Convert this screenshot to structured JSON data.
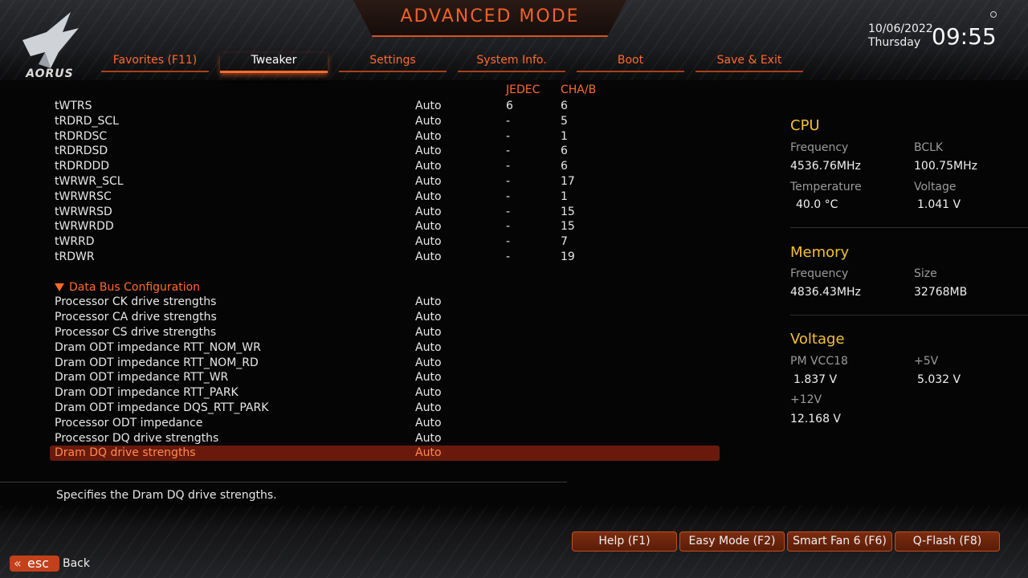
{
  "header": {
    "title": "ADVANCED MODE",
    "brand": "AORUS",
    "date": "10/06/2022",
    "day": "Thursday",
    "time": "09:55"
  },
  "tabs": [
    {
      "label": "Favorites (F11)",
      "active": false
    },
    {
      "label": "Tweaker",
      "active": true
    },
    {
      "label": "Settings",
      "active": false
    },
    {
      "label": "System Info.",
      "active": false
    },
    {
      "label": "Boot",
      "active": false
    },
    {
      "label": "Save & Exit",
      "active": false
    }
  ],
  "columns": {
    "jedec": "JEDEC",
    "chab": "CHA/B"
  },
  "rows": [
    {
      "label": "tWTRS",
      "value": "Auto",
      "jedec": "6",
      "chab": "6"
    },
    {
      "label": "tRDRD_SCL",
      "value": "Auto",
      "jedec": "-",
      "chab": "5"
    },
    {
      "label": "tRDRDSC",
      "value": "Auto",
      "jedec": "-",
      "chab": "1"
    },
    {
      "label": "tRDRDSD",
      "value": "Auto",
      "jedec": "-",
      "chab": "6"
    },
    {
      "label": "tRDRDDD",
      "value": "Auto",
      "jedec": "-",
      "chab": "6"
    },
    {
      "label": "tWRWR_SCL",
      "value": "Auto",
      "jedec": "-",
      "chab": "17"
    },
    {
      "label": "tWRWRSC",
      "value": "Auto",
      "jedec": "-",
      "chab": "1"
    },
    {
      "label": "tWRWRSD",
      "value": "Auto",
      "jedec": "-",
      "chab": "15"
    },
    {
      "label": "tWRWRDD",
      "value": "Auto",
      "jedec": "-",
      "chab": "15"
    },
    {
      "label": "tWRRD",
      "value": "Auto",
      "jedec": "-",
      "chab": "7"
    },
    {
      "label": "tRDWR",
      "value": "Auto",
      "jedec": "-",
      "chab": "19"
    },
    {
      "label": "",
      "value": "",
      "jedec": "",
      "chab": ""
    },
    {
      "label": "Data Bus Configuration",
      "value": "",
      "jedec": "",
      "chab": "",
      "section": true
    },
    {
      "label": "Processor CK drive strengths",
      "value": "Auto",
      "jedec": "",
      "chab": ""
    },
    {
      "label": "Processor CA drive strengths",
      "value": "Auto",
      "jedec": "",
      "chab": ""
    },
    {
      "label": "Processor CS drive strengths",
      "value": "Auto",
      "jedec": "",
      "chab": ""
    },
    {
      "label": "Dram ODT impedance RTT_NOM_WR",
      "value": "Auto",
      "jedec": "",
      "chab": ""
    },
    {
      "label": "Dram ODT impedance RTT_NOM_RD",
      "value": "Auto",
      "jedec": "",
      "chab": ""
    },
    {
      "label": "Dram ODT impedance RTT_WR",
      "value": "Auto",
      "jedec": "",
      "chab": ""
    },
    {
      "label": "Dram ODT impedance RTT_PARK",
      "value": "Auto",
      "jedec": "",
      "chab": ""
    },
    {
      "label": "Dram ODT impedance DQS_RTT_PARK",
      "value": "Auto",
      "jedec": "",
      "chab": ""
    },
    {
      "label": "Processor ODT impedance",
      "value": "Auto",
      "jedec": "",
      "chab": ""
    },
    {
      "label": "Processor DQ drive strengths",
      "value": "Auto",
      "jedec": "",
      "chab": ""
    },
    {
      "label": "Dram DQ drive strengths",
      "value": "Auto",
      "jedec": "",
      "chab": "",
      "selected": true
    }
  ],
  "description": "Specifies the Dram DQ drive strengths.",
  "side": {
    "cpu": {
      "title": "CPU",
      "frequency_label": "Frequency",
      "frequency": "4536.76MHz",
      "bclk_label": "BCLK",
      "bclk": "100.75MHz",
      "temperature_label": "Temperature",
      "temperature": "40.0 °C",
      "voltage_label": "Voltage",
      "voltage": "1.041 V"
    },
    "memory": {
      "title": "Memory",
      "frequency_label": "Frequency",
      "frequency": "4836.43MHz",
      "size_label": "Size",
      "size": "32768MB"
    },
    "voltage": {
      "title": "Voltage",
      "pmvcc18_label": "PM VCC18",
      "pmvcc18": "1.837 V",
      "p5v_label": "+5V",
      "p5v": "5.032 V",
      "p12v_label": "+12V",
      "p12v": "12.168 V"
    }
  },
  "footer": {
    "help": "Help (F1)",
    "easy": "Easy Mode (F2)",
    "smartfan": "Smart Fan 6 (F6)",
    "qflash": "Q-Flash (F8)",
    "esc": "esc",
    "back": "Back"
  },
  "colors": {
    "accent": "#ff6a2c",
    "highlight": "#f3c034",
    "selected_bg": "#6a1a0c"
  }
}
